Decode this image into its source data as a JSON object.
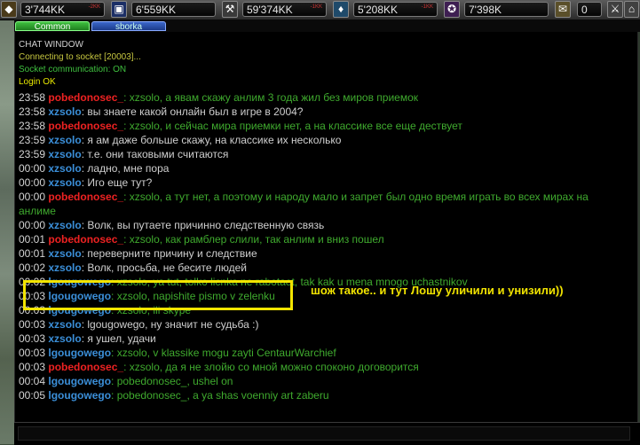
{
  "resources": [
    {
      "value": "3'744KK",
      "change": "-2KK",
      "icon": "gem-icon",
      "color": "#c8b45a"
    },
    {
      "value": "6'559KK",
      "change": "",
      "icon": "cube-icon",
      "color": "#3b5fb0"
    },
    {
      "value": "59'374KK",
      "change": "-1KK",
      "icon": "pickaxe-icon",
      "color": "#a0a0a0"
    },
    {
      "value": "5'208KK",
      "change": "-1KK",
      "icon": "crystal-icon",
      "color": "#3b9bd9"
    },
    {
      "value": "7'398K",
      "change": "",
      "icon": "mana-icon",
      "color": "#9a3fc0"
    },
    {
      "value": "0",
      "change": "",
      "icon": "scroll-icon",
      "color": "#d0c080"
    }
  ],
  "tabs": {
    "common": "Common",
    "sborka": "sborka"
  },
  "chat": {
    "header": "CHAT WINDOW",
    "system": [
      {
        "text": "Connecting to socket [20003]...",
        "color": "#c7c740"
      },
      {
        "text": "Socket communication: ON",
        "color": "#3fc03f"
      },
      {
        "text": "Login OK",
        "color": "#e8e800"
      }
    ],
    "messages": [
      {
        "time": "23:58",
        "name": "pobedonosec_",
        "nc": "nr",
        "text": ": xzsolo, а явам скажу анлим 3 года жил без миров приемок",
        "tc": "mg"
      },
      {
        "time": "23:58",
        "name": "xzsolo",
        "nc": "nb",
        "text": ": вы знаете какой онлайн был в игре в 2004?",
        "tc": "mw"
      },
      {
        "time": "23:58",
        "name": "pobedonosec_",
        "nc": "nr",
        "text": ": xzsolo, и сейчас мира приемки нет, а на классике все еще дествует",
        "tc": "mg"
      },
      {
        "time": "23:59",
        "name": "xzsolo",
        "nc": "nb",
        "text": ": я ам даже больше скажу, на классике их несколько",
        "tc": "mw"
      },
      {
        "time": "23:59",
        "name": "xzsolo",
        "nc": "nb",
        "text": ": т.е. они таковыми считаются",
        "tc": "mw"
      },
      {
        "time": "00:00",
        "name": "xzsolo",
        "nc": "nb",
        "text": ": ладно, мне пора",
        "tc": "mw"
      },
      {
        "time": "00:00",
        "name": "xzsolo",
        "nc": "nb",
        "text": ": Иго еще тут?",
        "tc": "mw"
      },
      {
        "time": "00:00",
        "name": "pobedonosec_",
        "nc": "nr",
        "text": ": xzsolo, а тут нет, а поэтому и народу мало и запрет был одно время играть во всех мирах на",
        "tc": "mg"
      },
      {
        "time": "",
        "name": "",
        "nc": "",
        "text": "анлиме",
        "tc": "mg"
      },
      {
        "time": "00:00",
        "name": "xzsolo",
        "nc": "nb",
        "text": ": Волк, вы путаете причинно следственную связь",
        "tc": "mw"
      },
      {
        "time": "00:01",
        "name": "pobedonosec_",
        "nc": "nr",
        "text": ": xzsolo, как рамблер слили, так анлим и вниз пошел",
        "tc": "mg"
      },
      {
        "time": "00:01",
        "name": "xzsolo",
        "nc": "nb",
        "text": ": переверните причину и следствие",
        "tc": "mw"
      },
      {
        "time": "00:02",
        "name": "xzsolo",
        "nc": "nb",
        "text": ": Волк, просьба, не бесите людей",
        "tc": "mw"
      },
      {
        "time": "00:02",
        "name": "lgougowego",
        "nc": "nb",
        "text": ": xzsolo, ya tut, tolko licnka ne rabotaet, tak kak u mena mnogo uchastnikov",
        "tc": "mg"
      },
      {
        "time": "00:03",
        "name": "lgougowego",
        "nc": "nb",
        "text": ": xzsolo, napishite pismo v zelenku",
        "tc": "mg"
      },
      {
        "time": "00:03",
        "name": "lgougowego",
        "nc": "nb",
        "text": ": xzsolo, ili skype",
        "tc": "mg"
      },
      {
        "time": "00:03",
        "name": "xzsolo",
        "nc": "nb",
        "text": ": lgougowego, ну значит не судьба :)",
        "tc": "mw"
      },
      {
        "time": "00:03",
        "name": "xzsolo",
        "nc": "nb",
        "text": ": я ушел, удачи",
        "tc": "mw"
      },
      {
        "time": "00:03",
        "name": "lgougowego",
        "nc": "nb",
        "text": ": xzsolo, v klassike mogu zayti CentaurWarchief",
        "tc": "mg"
      },
      {
        "time": "00:03",
        "name": "pobedonosec_",
        "nc": "nr",
        "text": ": xzsolo, да я не злойю со мной можно споконо договорится",
        "tc": "mg"
      },
      {
        "time": "00:04",
        "name": "lgougowego",
        "nc": "nb",
        "text": ": pobedonosec_, ushel on",
        "tc": "mg"
      },
      {
        "time": "00:05",
        "name": "lgougowego",
        "nc": "nb",
        "text": ": pobedonosec_, a ya shas voenniy art zaberu",
        "tc": "mg"
      }
    ]
  },
  "annotation": "шож такое.. и тут Лошу уличили и унизили))",
  "highlight_color": "#f2e400",
  "input": {
    "value": ""
  }
}
